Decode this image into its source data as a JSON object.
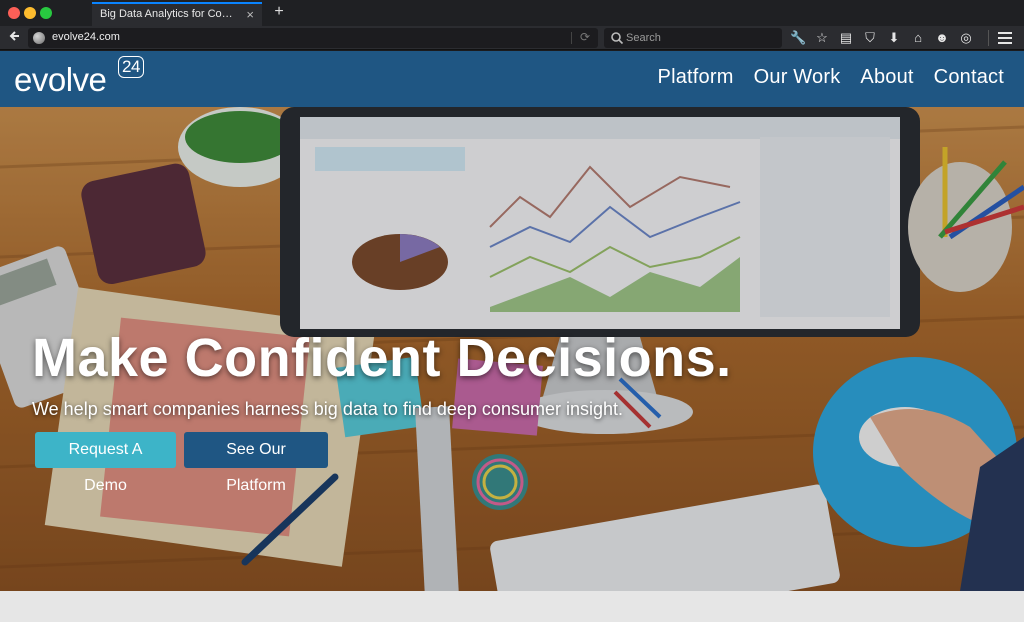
{
  "browser": {
    "tab_title": "Big Data Analytics for Consume...",
    "tab_close": "×",
    "new_tab": "+",
    "url": "evolve24.com",
    "search_placeholder": "Search",
    "toolbar_icons": [
      "wrench-icon",
      "star-icon",
      "reader-icon",
      "pocket-icon",
      "download-icon",
      "home-icon",
      "chat-icon",
      "palette-icon"
    ],
    "toolbar_glyphs": [
      "🔧",
      "☆",
      "▤",
      "⛉",
      "⬇",
      "⌂",
      "☻",
      "◎"
    ]
  },
  "header": {
    "logo_text": "evolve",
    "logo_number": "24",
    "nav": [
      {
        "label": "Platform"
      },
      {
        "label": "Our Work"
      },
      {
        "label": "About"
      },
      {
        "label": "Contact"
      }
    ]
  },
  "hero": {
    "title": "Make Confident Decisions.",
    "subtitle": "We help smart companies harness big data to find deep consumer insight.",
    "buttons": [
      {
        "label": "Request A Demo"
      },
      {
        "label": "See Our Platform"
      }
    ]
  },
  "colors": {
    "header_bg": "#1f5683",
    "demo_button": "#3db4c8",
    "platform_button": "#1f5683"
  }
}
